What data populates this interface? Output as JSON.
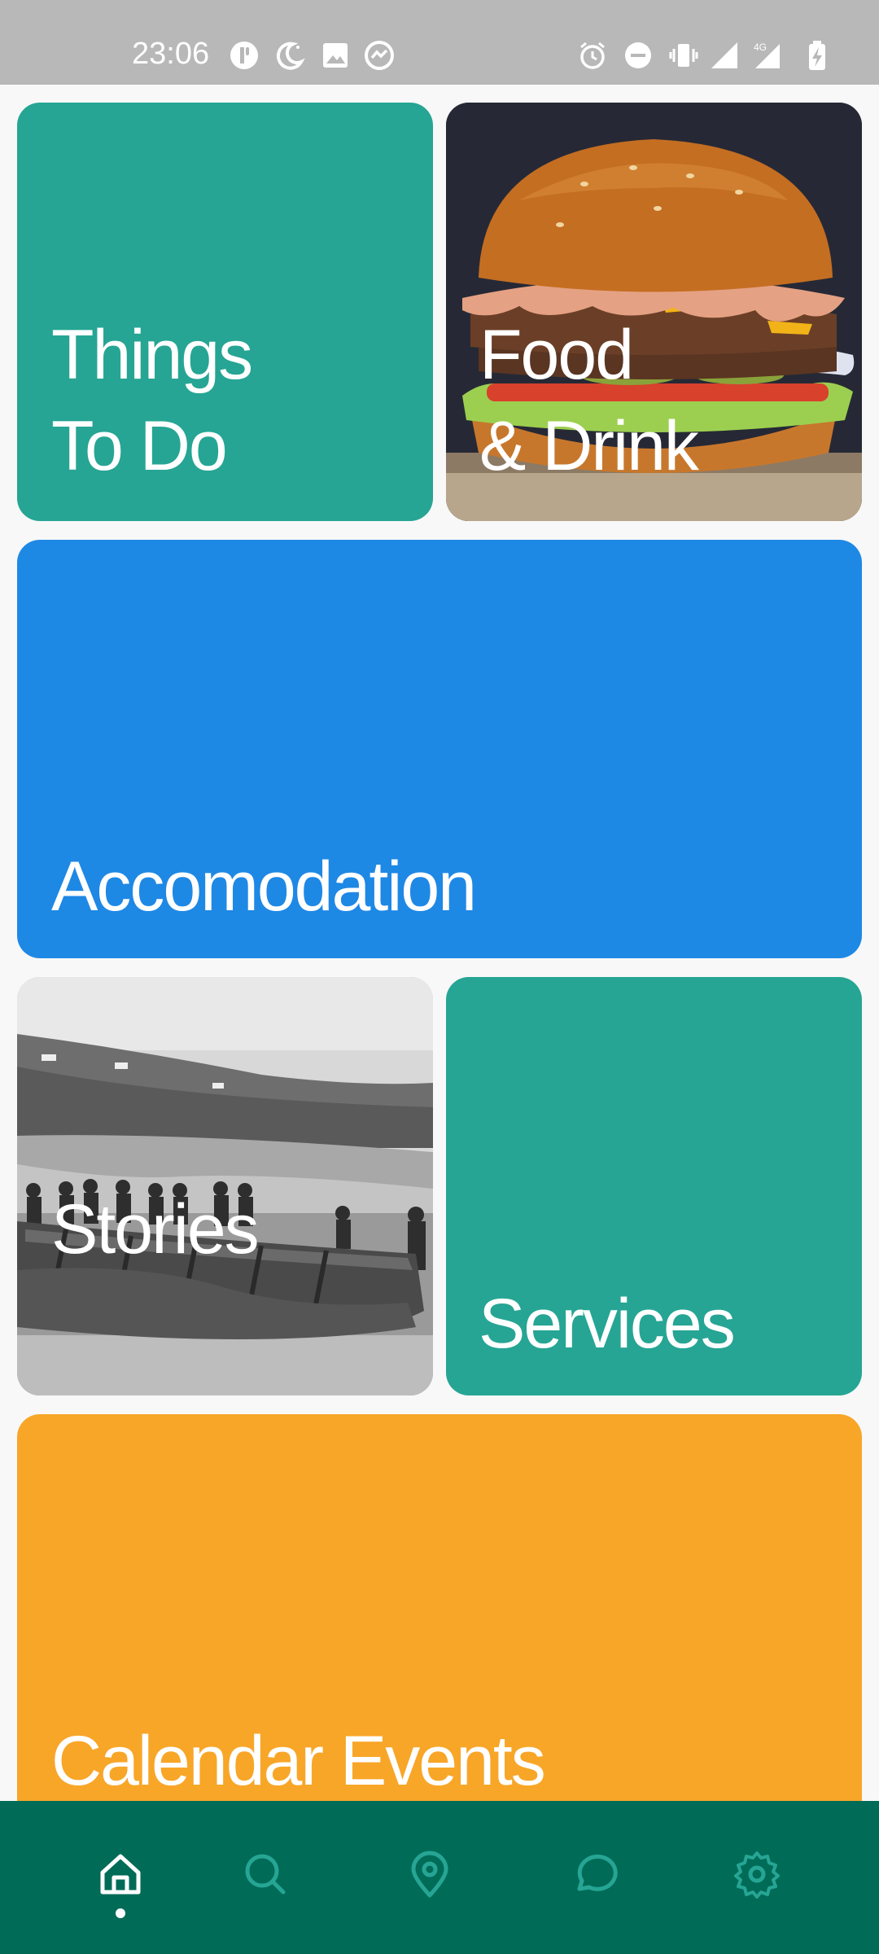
{
  "status_bar": {
    "time": "23:06",
    "left_icons": [
      "app-notification-icon",
      "do-not-disturb-moon-icon",
      "gallery-icon",
      "messenger-icon"
    ],
    "right_icons": [
      "alarm-icon",
      "dnd-minus-icon",
      "vibrate-icon",
      "signal-roaming-icon",
      "signal-4g-icon",
      "battery-charging-icon"
    ],
    "network_label": "4G"
  },
  "tiles": [
    {
      "id": "things-to-do",
      "label": "Things\nTo Do",
      "color": "#26a594"
    },
    {
      "id": "food-drink",
      "label": "Food\n& Drink",
      "image": "burger-photo"
    },
    {
      "id": "accomodation",
      "label": "Accomodation",
      "color": "#1e88e5"
    },
    {
      "id": "stories",
      "label": "Stories",
      "image": "boats-photo"
    },
    {
      "id": "services",
      "label": "Services",
      "color": "#26a594"
    },
    {
      "id": "calendar-events",
      "label": "Calendar Events",
      "color": "#f8a628"
    }
  ],
  "bottom_nav": {
    "background": "#006b57",
    "items": [
      {
        "icon": "home-icon",
        "active": true
      },
      {
        "icon": "search-icon",
        "active": false
      },
      {
        "icon": "map-pin-icon",
        "active": false
      },
      {
        "icon": "chat-icon",
        "active": false
      },
      {
        "icon": "settings-gear-icon",
        "active": false
      }
    ]
  }
}
